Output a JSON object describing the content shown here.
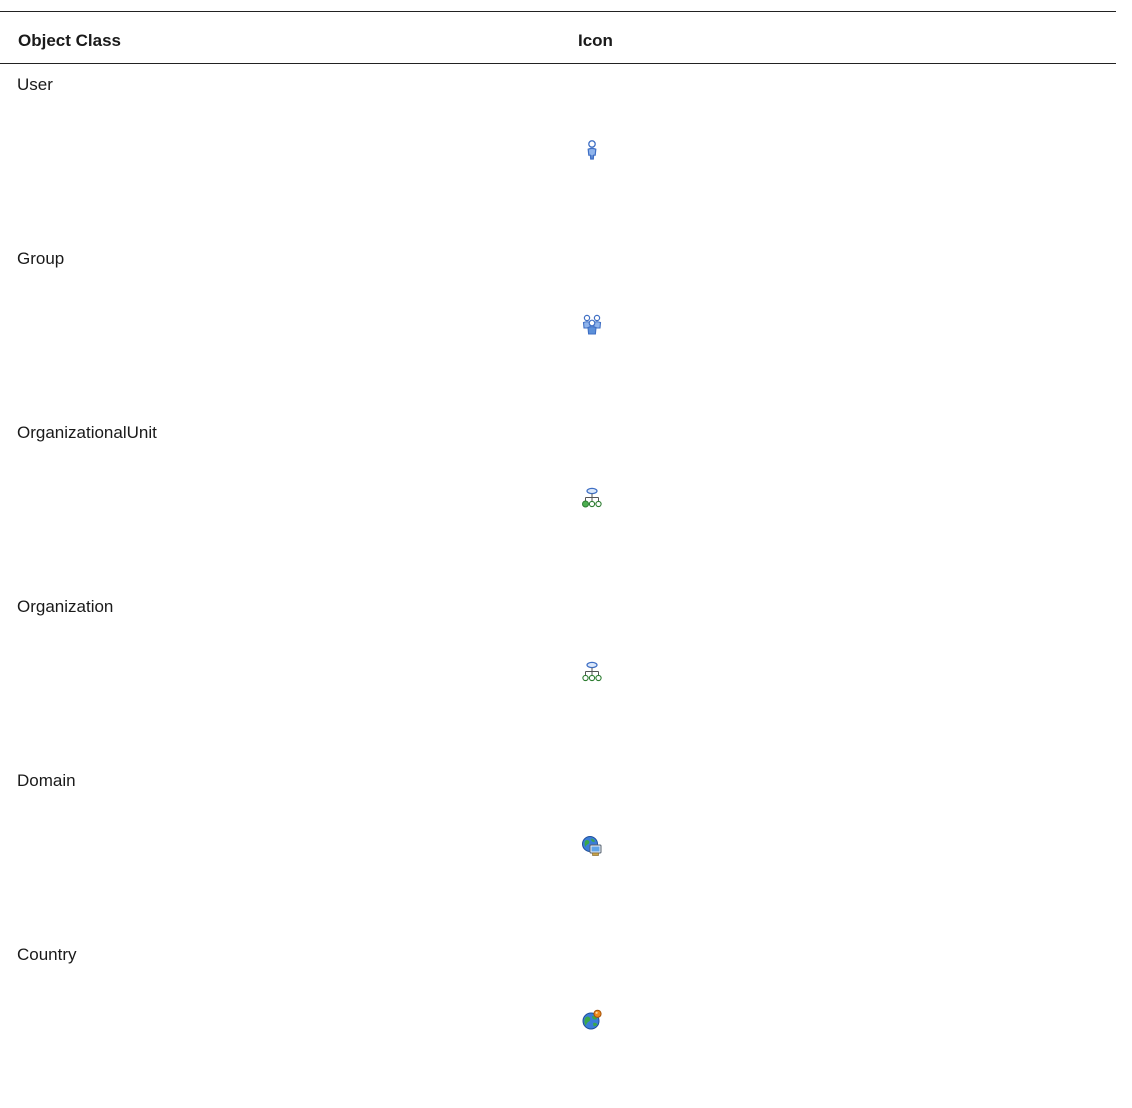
{
  "table": {
    "headers": {
      "object_class": "Object Class",
      "icon": "Icon"
    },
    "rows": [
      {
        "object_class": "User",
        "icon": "user-icon"
      },
      {
        "object_class": "Group",
        "icon": "group-icon"
      },
      {
        "object_class": "OrganizationalUnit",
        "icon": "organizational-unit-icon"
      },
      {
        "object_class": "Organization",
        "icon": "organization-icon"
      },
      {
        "object_class": "Domain",
        "icon": "domain-icon"
      },
      {
        "object_class": "Country",
        "icon": "country-icon"
      }
    ]
  },
  "colors": {
    "user_blue": "#5b8fd9",
    "tree_green": "#4caf50",
    "globe_blue": "#3b7dd8",
    "globe_green": "#3aa84a",
    "accent_orange": "#f08a1c"
  }
}
